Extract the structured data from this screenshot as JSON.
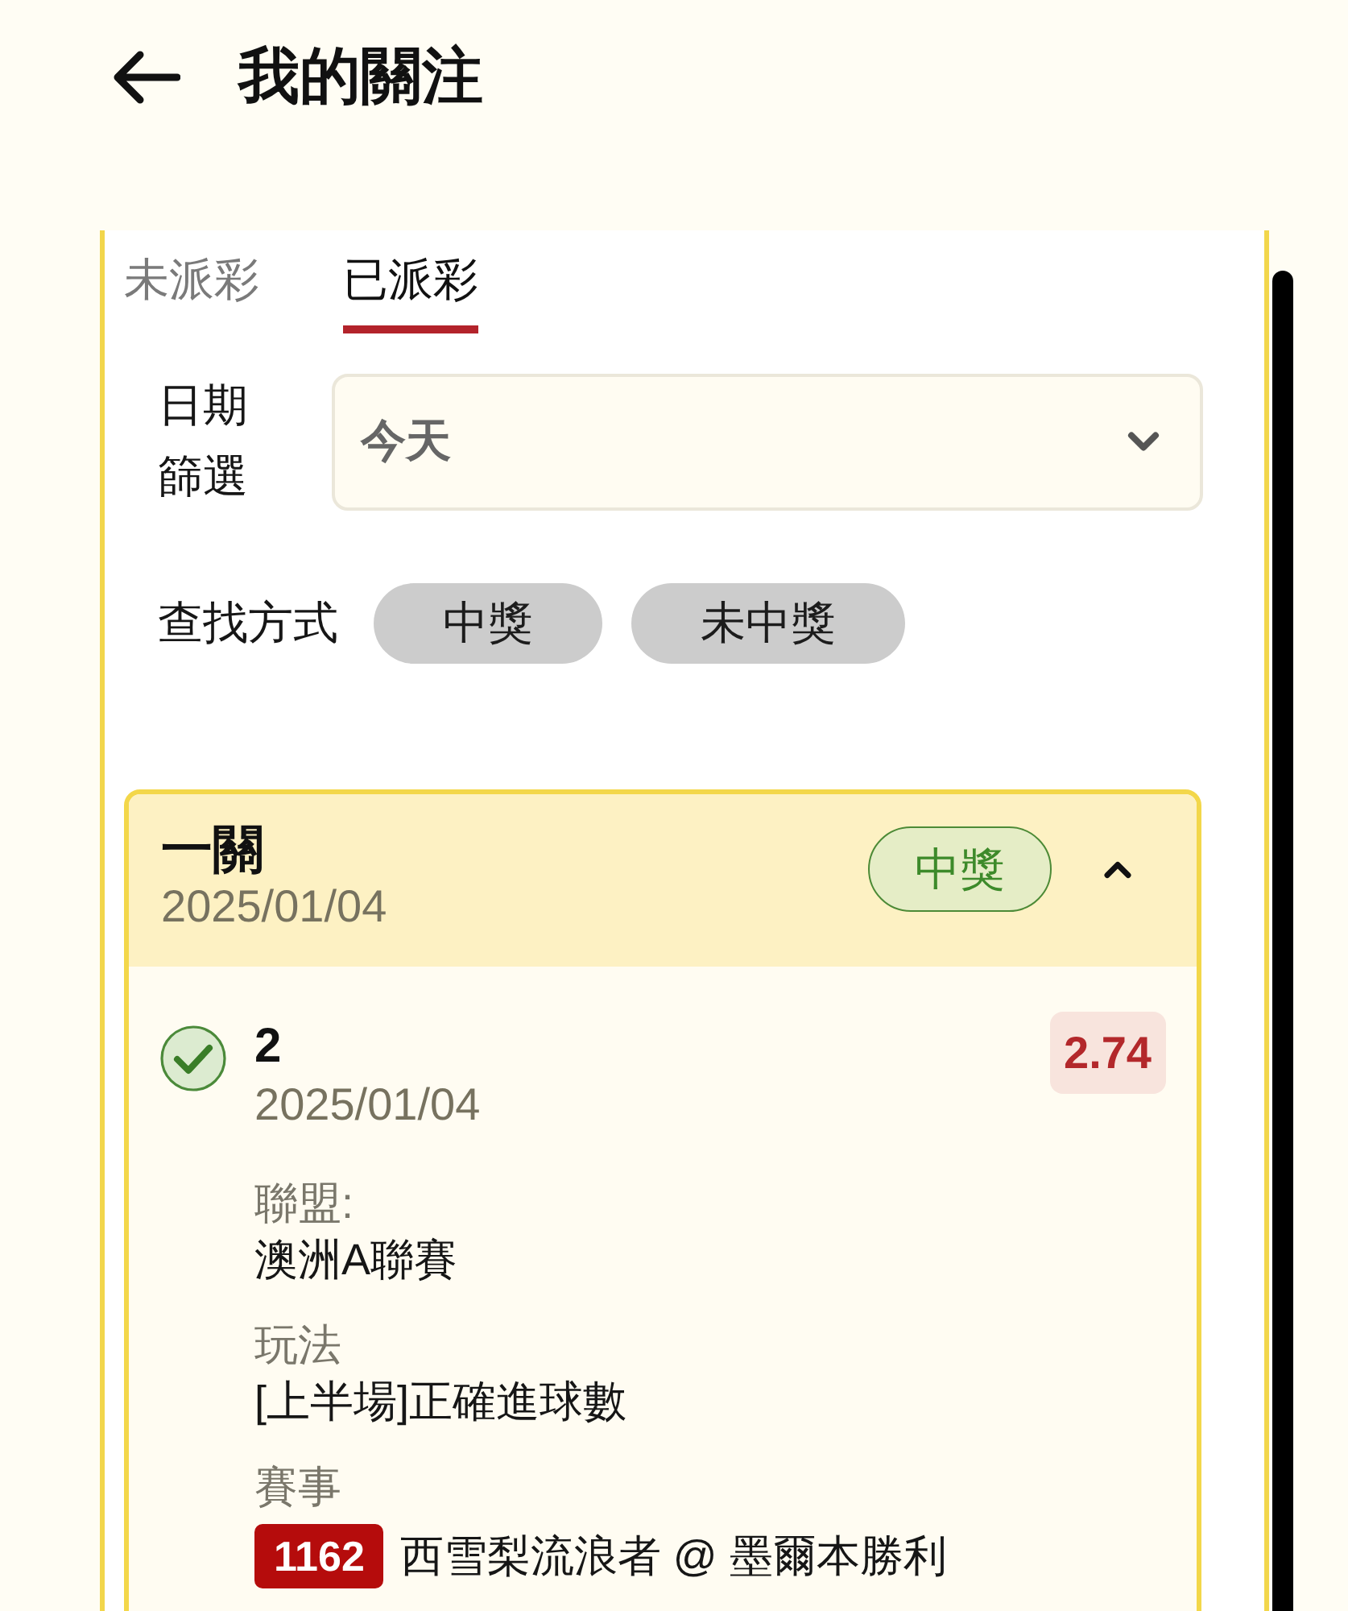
{
  "header": {
    "title": "我的關注"
  },
  "tabs": [
    {
      "label": "未派彩",
      "selected": false
    },
    {
      "label": "已派彩",
      "selected": true
    }
  ],
  "date_filter": {
    "label": "日期篩選",
    "value": "今天"
  },
  "search_mode": {
    "label": "查找方式",
    "options": [
      {
        "label": "中獎",
        "selected": false
      },
      {
        "label": "未中獎",
        "selected": false
      }
    ]
  },
  "bets": [
    {
      "type": "一關",
      "date": "2025/01/04",
      "result": "中獎",
      "won": true,
      "expanded": true,
      "legs": [
        {
          "won": true,
          "selection": "2",
          "date": "2025/01/04",
          "odds": "2.74",
          "fields": [
            {
              "kind": "text",
              "label": "聯盟:",
              "value": "澳洲A聯賽"
            },
            {
              "kind": "text",
              "label": "玩法",
              "value": "[上半場]正確進球數"
            },
            {
              "kind": "match",
              "label": "賽事",
              "match_no": "1162",
              "value": "西雪梨流浪者 @ 墨爾本勝利"
            }
          ]
        }
      ]
    }
  ]
}
